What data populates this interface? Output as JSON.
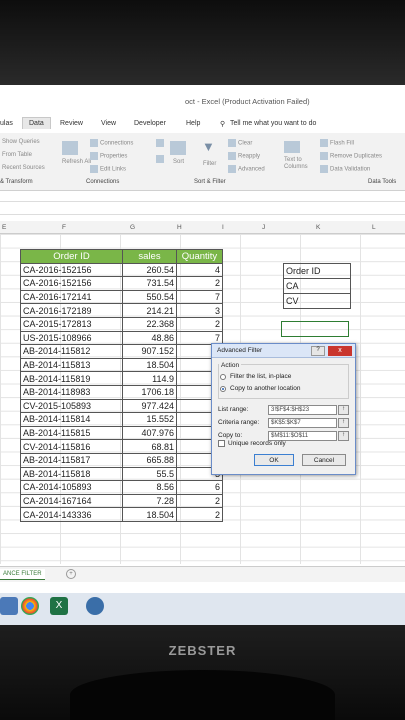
{
  "window": {
    "title": "oct - Excel (Product Activation Failed)"
  },
  "tabs": [
    "ulas",
    "Data",
    "Review",
    "View",
    "Developer",
    "Help"
  ],
  "tell_me": "Tell me what you want to do",
  "ribbon": {
    "show_queries": "Show Queries",
    "from_table": "From Table",
    "recent_sources": "Recent Sources",
    "transform": "& Transform",
    "connections": "Connections",
    "properties": "Properties",
    "edit_links": "Edit Links",
    "refresh_all": "Refresh All",
    "connections_group": "Connections",
    "sort": "Sort",
    "filter": "Filter",
    "clear": "Clear",
    "reapply": "Reapply",
    "advanced": "Advanced",
    "sort_filter_group": "Sort & Filter",
    "text_to_columns": "Text to Columns",
    "flash_fill": "Flash Fill",
    "remove_duplicates": "Remove Duplicates",
    "data_validation": "Data Validation",
    "data_tools_group": "Data Tools"
  },
  "columns": [
    "E",
    "F",
    "G",
    "H",
    "I",
    "J",
    "K",
    "L"
  ],
  "table": {
    "headers": [
      "Order ID",
      "sales",
      "Quantity"
    ],
    "rows": [
      [
        "CA-2016-152156",
        "260.54",
        "4"
      ],
      [
        "CA-2016-152156",
        "731.54",
        "2"
      ],
      [
        "CA-2016-172141",
        "550.54",
        "7"
      ],
      [
        "CA-2016-172189",
        "214.21",
        "3"
      ],
      [
        "CA-2015-172813",
        "22.368",
        "2"
      ],
      [
        "US-2015-108966",
        "48.86",
        "7"
      ],
      [
        "AB-2014-115812",
        "907.152",
        "4"
      ],
      [
        "AB-2014-115813",
        "18.504",
        "6"
      ],
      [
        "AB-2014-115819",
        "114.9",
        "3"
      ],
      [
        "AB-2014-118983",
        "1706.18",
        "5"
      ],
      [
        "CV-2015-105893",
        "977.424",
        "9"
      ],
      [
        "AB-2014-115814",
        "15.552",
        "4"
      ],
      [
        "AB-2014-115815",
        "407.976",
        "3"
      ],
      [
        "CV-2014-115816",
        "68.81",
        "3"
      ],
      [
        "AB-2014-115817",
        "665.88",
        "5"
      ],
      [
        "AB-2014-115818",
        "55.5",
        "3"
      ],
      [
        "CA-2014-105893",
        "8.56",
        "6"
      ],
      [
        "CA-2014-167164",
        "7.28",
        "2"
      ],
      [
        "CA-2014-143336",
        "18.504",
        "2"
      ]
    ]
  },
  "criteria": [
    "Order ID",
    "CA",
    "CV"
  ],
  "dialog": {
    "title": "Advanced Filter",
    "help": "?",
    "close": "x",
    "action_label": "Action",
    "opt_inplace": "Filter the list, in-place",
    "opt_copy": "Copy to another location",
    "list_range_label": "List range:",
    "list_range_value": "3!$F$4:$H$23",
    "criteria_range_label": "Criteria range:",
    "criteria_range_value": "$K$5:$K$7",
    "copy_to_label": "Copy to:",
    "copy_to_value": "$M$11:$O$11",
    "unique_label": "Unique records only",
    "ok": "OK",
    "cancel": "Cancel"
  },
  "sheet_tab": "ANCE FILTER",
  "brand": "ZEBSTER"
}
